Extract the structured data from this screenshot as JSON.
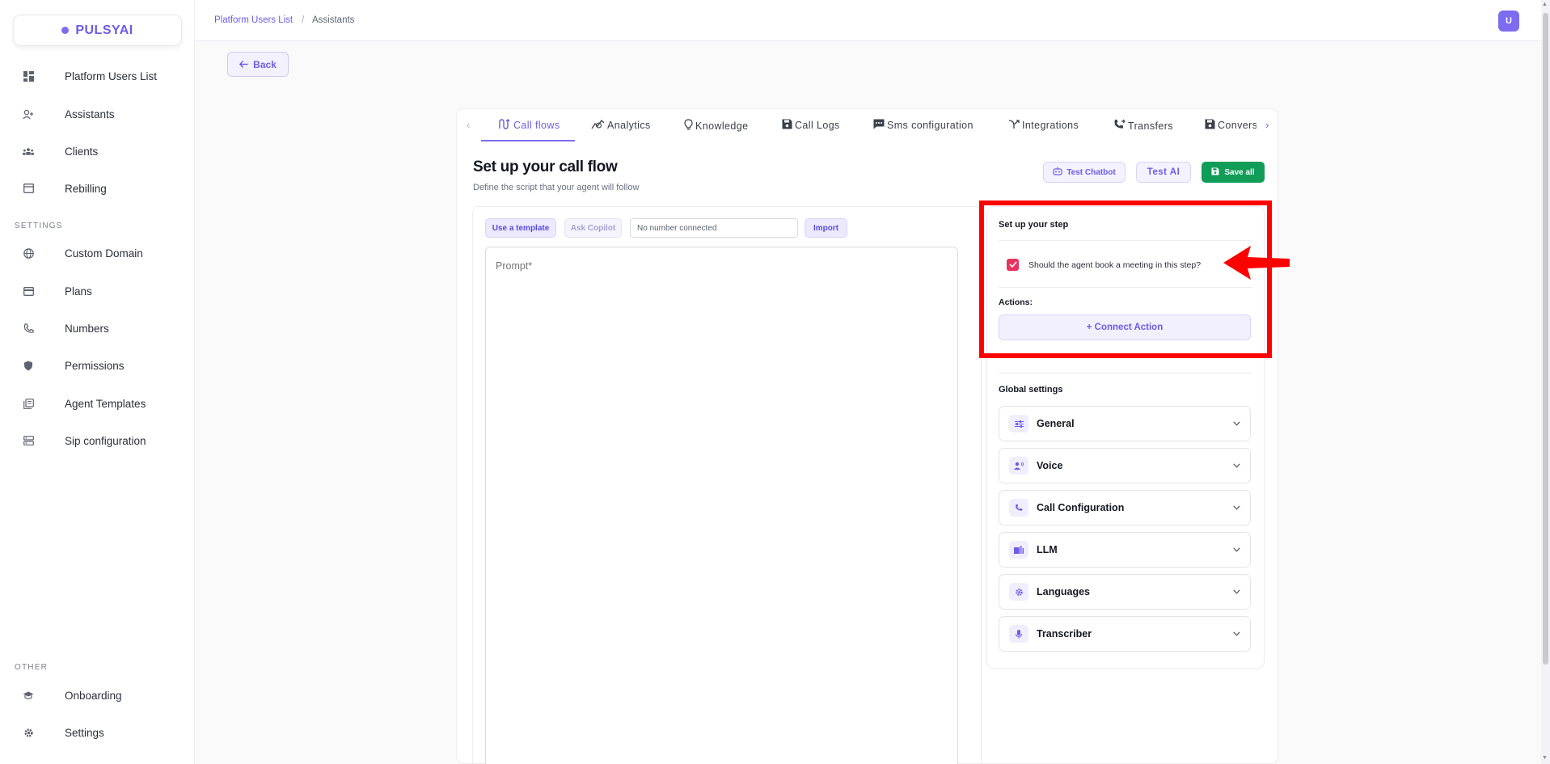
{
  "app": {
    "logo": "PULSYAI"
  },
  "sidebar": {
    "items": [
      {
        "label": "Platform Users List",
        "icon": "dashboard-icon"
      },
      {
        "label": "Assistants",
        "icon": "user-plus-icon"
      },
      {
        "label": "Clients",
        "icon": "group-icon"
      },
      {
        "label": "Rebilling",
        "icon": "store-icon"
      }
    ],
    "settings_label": "SETTINGS",
    "settings_items": [
      {
        "label": "Custom Domain",
        "icon": "globe-icon"
      },
      {
        "label": "Plans",
        "icon": "credit-card-icon"
      },
      {
        "label": "Numbers",
        "icon": "phone-icon"
      },
      {
        "label": "Permissions",
        "icon": "shield-icon"
      },
      {
        "label": "Agent Templates",
        "icon": "library-icon"
      },
      {
        "label": "Sip configuration",
        "icon": "server-icon"
      }
    ],
    "other_label": "OTHER",
    "other_items": [
      {
        "label": "Onboarding",
        "icon": "graduation-cap-icon"
      },
      {
        "label": "Settings",
        "icon": "gear-icon"
      }
    ]
  },
  "header": {
    "breadcrumb": [
      "Platform Users List",
      "/",
      "Assistants"
    ],
    "avatar": "U"
  },
  "back_label": "Back",
  "tabs": [
    {
      "label": "Call flows",
      "icon": "flow-icon",
      "active": true
    },
    {
      "label": "Analytics",
      "icon": "analytics-icon"
    },
    {
      "label": "Knowledge",
      "icon": "lightbulb-icon"
    },
    {
      "label": "Call Logs",
      "icon": "save-icon"
    },
    {
      "label": "Sms configuration",
      "icon": "sms-icon"
    },
    {
      "label": "Integrations",
      "icon": "merge-icon"
    },
    {
      "label": "Transfers",
      "icon": "phone-forward-icon"
    },
    {
      "label": "Convers",
      "icon": "save-icon"
    }
  ],
  "main": {
    "title": "Set up your call flow",
    "subtitle": "Define the script that your agent will follow",
    "test_chatbot": "Test Chatbot",
    "test_ai": "Test AI",
    "save_all": "Save all"
  },
  "editor": {
    "use_template": "Use a template",
    "ask_copilot": "Ask Copilot",
    "number_value": "No number connected",
    "import": "Import",
    "prompt_placeholder": "Prompt*"
  },
  "step": {
    "title": "Set up your step",
    "checkbox_label": "Should the agent book a meeting in this step?",
    "checkbox_checked": true,
    "actions_label": "Actions:",
    "connect_action": "+ Connect Action"
  },
  "global": {
    "title": "Global settings",
    "sections": [
      {
        "label": "General",
        "icon": "sliders-icon"
      },
      {
        "label": "Voice",
        "icon": "voice-icon"
      },
      {
        "label": "Call Configuration",
        "icon": "phone-icon"
      },
      {
        "label": "LLM",
        "icon": "model-icon"
      },
      {
        "label": "Languages",
        "icon": "gear-icon"
      },
      {
        "label": "Transcriber",
        "icon": "mic-icon"
      }
    ]
  },
  "colors": {
    "accent": "#6c5ce7",
    "save": "#0f9d58",
    "checkbox": "#e8335e",
    "highlight": "#ff0000"
  }
}
